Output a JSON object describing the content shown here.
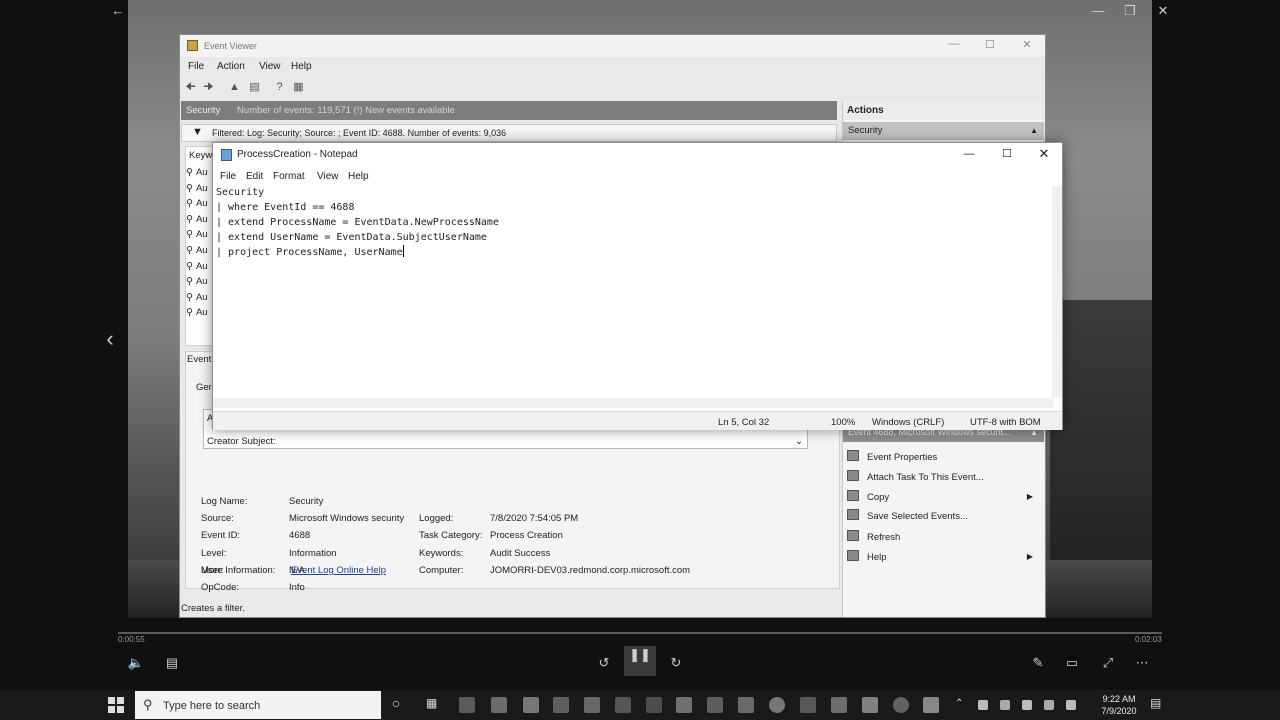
{
  "event_viewer": {
    "title": "Event Viewer",
    "menu": [
      "File",
      "Action",
      "View",
      "Help"
    ],
    "header_name": "Security",
    "header_info": "Number of events: 119,571 (!) New events available",
    "filter_text": "Filtered: Log: Security; Source: ; Event ID: 4688. Number of events: 9,036",
    "list_header": "Keyw",
    "list_rows": [
      "Au",
      "Au",
      "Au",
      "Au",
      "Au",
      "Au",
      "Au",
      "Au",
      "Au",
      "Au"
    ],
    "detail_tab": "Event",
    "general_tab": "Gen",
    "box_first": "A",
    "creator_subject": "Creator Subject:",
    "fields": {
      "log_name_label": "Log Name:",
      "log_name": "Security",
      "source_label": "Source:",
      "source": "Microsoft Windows security",
      "logged_label": "Logged:",
      "logged": "7/8/2020 7:54:05 PM",
      "event_id_label": "Event ID:",
      "event_id": "4688",
      "task_category_label": "Task Category:",
      "task_category": "Process Creation",
      "level_label": "Level:",
      "level": "Information",
      "keywords_label": "Keywords:",
      "keywords": "Audit Success",
      "user_label": "User:",
      "user": "N/A",
      "computer_label": "Computer:",
      "computer": "JOMORRI-DEV03.redmond.corp.microsoft.com",
      "opcode_label": "OpCode:",
      "opcode": "Info",
      "more_info_label": "More Information:",
      "more_info_link": "Event Log Online Help"
    },
    "status_bar": "Creates a filter.",
    "actions": {
      "title": "Actions",
      "section1": "Security",
      "section2": "Event 4688, Microsoft Windows securit...",
      "items": [
        "Event Properties",
        "Attach Task To This Event...",
        "Copy",
        "Save Selected Events...",
        "Refresh",
        "Help"
      ]
    }
  },
  "notepad": {
    "title": "ProcessCreation - Notepad",
    "menu": [
      "File",
      "Edit",
      "Format",
      "View",
      "Help"
    ],
    "lines": [
      "Security",
      "| where EventId == 4688",
      "| extend ProcessName = EventData.NewProcessName",
      "| extend UserName = EventData.SubjectUserName",
      "| project ProcessName, UserName"
    ],
    "status": {
      "position": "Ln 5, Col 32",
      "zoom": "100%",
      "line_ending": "Windows (CRLF)",
      "encoding": "UTF-8 with BOM"
    }
  },
  "player": {
    "time_elapsed": "0:00:55",
    "time_total": "0:02:03"
  },
  "taskbar": {
    "search_placeholder": "Type here to search",
    "clock_time": "9:22 AM",
    "clock_date": "7/9/2020"
  },
  "colors": {
    "header_bar": "#7d7d7d",
    "actions_selected": "#8e8e8e",
    "link": "#1f3f8f"
  }
}
